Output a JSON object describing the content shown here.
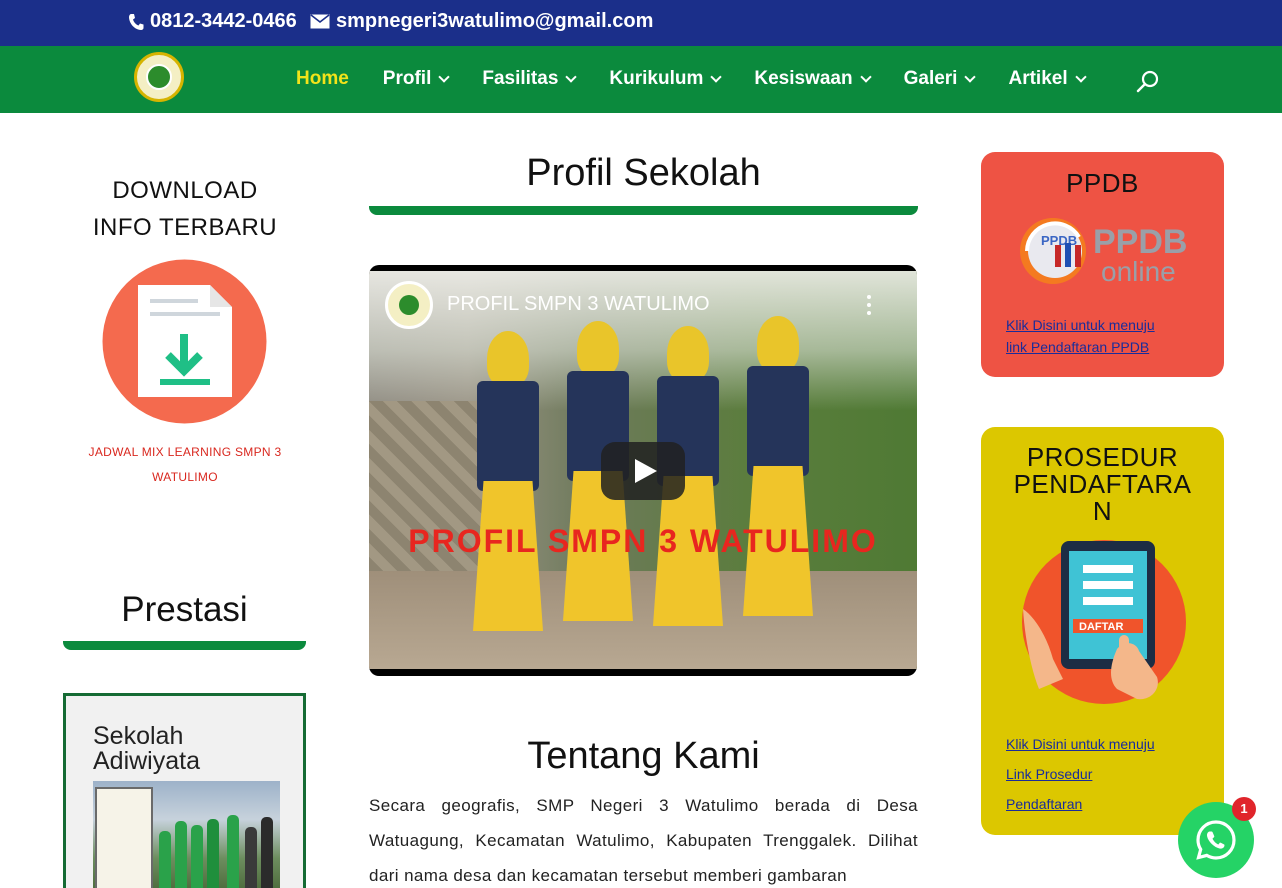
{
  "topbar": {
    "phone": "0812-3442-0466",
    "email": "smpnegeri3watulimo@gmail.com",
    "phone_icon": "phone-icon",
    "email_icon": "envelope-icon"
  },
  "nav": {
    "logo_icon": "school-logo-icon",
    "items": [
      {
        "label": "Home",
        "active": true
      },
      {
        "label": "Profil",
        "dropdown": true
      },
      {
        "label": "Fasilitas",
        "dropdown": true
      },
      {
        "label": "Kurikulum",
        "dropdown": true
      },
      {
        "label": "Kesiswaan",
        "dropdown": true
      },
      {
        "label": "Galeri",
        "dropdown": true
      },
      {
        "label": "Artikel",
        "dropdown": true
      }
    ],
    "search_icon": "search-icon"
  },
  "left": {
    "download_title_1": "DOWNLOAD",
    "download_title_2": "INFO TERBARU",
    "download_link_1": "JADWAL MIX LEARNING SMPN 3",
    "download_link_2": "WATULIMO",
    "prestasi_title": "Prestasi",
    "adiwiyata_1": "Sekolah",
    "adiwiyata_2": "Adiwiyata"
  },
  "center": {
    "profil_title": "Profil Sekolah",
    "video": {
      "title": "PROFIL SMPN 3 WATULIMO",
      "overlay_text": "PROFIL SMPN 3 WATULIMO"
    },
    "tentang_title": "Tentang Kami",
    "paragraph": "Secara geografis, SMP Negeri 3 Watulimo berada di Desa Watuagung, Kecamatan Watulimo, Kabupaten Trenggalek. Dilihat dari nama desa dan kecamatan tersebut memberi gambaran"
  },
  "right": {
    "ppdb_title": "PPDB",
    "ppdb_link_1": "Klik Disini untuk menuju",
    "ppdb_link_2": "link Pendaftaran PPDB",
    "ppdb_logo_text": "PPDB",
    "ppdb_logo_sub": "online",
    "prosedur_title_1": "PROSEDUR",
    "prosedur_title_2": "PENDAFTARA",
    "prosedur_title_3": "N",
    "prosedur_ill_label": "DAFTAR",
    "prosedur_link_1": "Klik Disini untuk menuju",
    "prosedur_link_2": "Link Prosedur",
    "prosedur_link_3": "Pendaftaran"
  },
  "whatsapp": {
    "badge": "1",
    "icon": "whatsapp-icon"
  },
  "colors": {
    "topbar": "#1b2f8a",
    "nav": "#0b8a3d",
    "nav_active": "#f2e31a",
    "ppdb_card": "#ee5344",
    "prosedur_card": "#dcc700",
    "link": "#1a2c9a",
    "download_link": "#d9281f"
  }
}
